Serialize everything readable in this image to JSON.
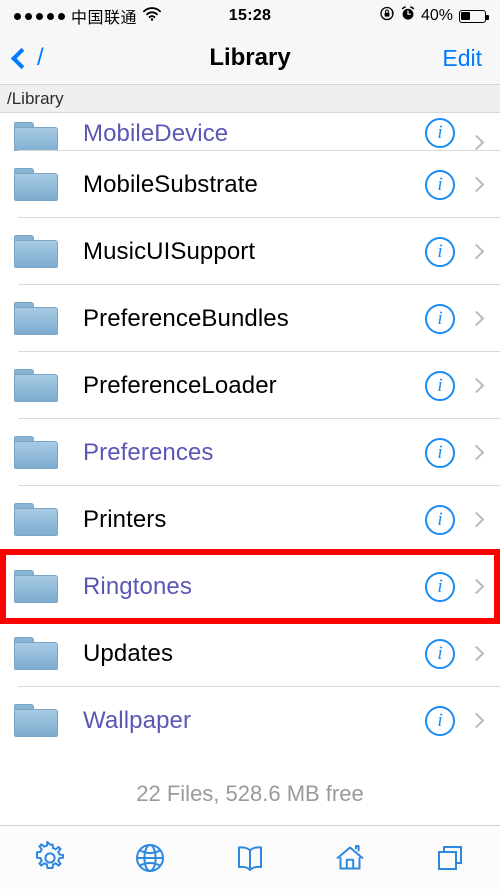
{
  "status_bar": {
    "signal_dots": 5,
    "carrier": "中国联通",
    "wifi_icon": "wifi-icon",
    "time": "15:28",
    "rotation_lock_icon": "rotation-lock-icon",
    "alarm_icon": "alarm-clock-icon",
    "battery_percent": "40%",
    "battery_level": 40
  },
  "nav_bar": {
    "back_label": "/",
    "back_icon": "chevron-left-icon",
    "title": "Library",
    "edit_label": "Edit"
  },
  "path_bar": {
    "path": "/Library"
  },
  "list": {
    "items": [
      {
        "name": "MobileDevice",
        "style": "link",
        "clipped": true
      },
      {
        "name": "MobileSubstrate",
        "style": "normal",
        "clipped": false
      },
      {
        "name": "MusicUISupport",
        "style": "normal",
        "clipped": false
      },
      {
        "name": "PreferenceBundles",
        "style": "normal",
        "clipped": false
      },
      {
        "name": "PreferenceLoader",
        "style": "normal",
        "clipped": false
      },
      {
        "name": "Preferences",
        "style": "link",
        "clipped": false
      },
      {
        "name": "Printers",
        "style": "normal",
        "clipped": false
      },
      {
        "name": "Ringtones",
        "style": "link",
        "clipped": false,
        "highlighted": true
      },
      {
        "name": "Updates",
        "style": "normal",
        "clipped": false
      },
      {
        "name": "Wallpaper",
        "style": "link",
        "clipped": false,
        "last": true
      }
    ],
    "info_glyph": "i",
    "footer": "22 Files, 528.6 MB free"
  },
  "tab_bar": {
    "items": [
      {
        "icon": "gear-icon"
      },
      {
        "icon": "globe-icon"
      },
      {
        "icon": "book-icon"
      },
      {
        "icon": "home-icon"
      },
      {
        "icon": "copy-windows-icon"
      }
    ]
  },
  "colors": {
    "ios_blue": "#007aff",
    "icon_blue": "#1b8cf0",
    "visited_link": "#5a57b5",
    "highlight_red": "#fe0000",
    "folder_blue": "#8fb9d8",
    "footer_gray": "#9a9a9a"
  }
}
